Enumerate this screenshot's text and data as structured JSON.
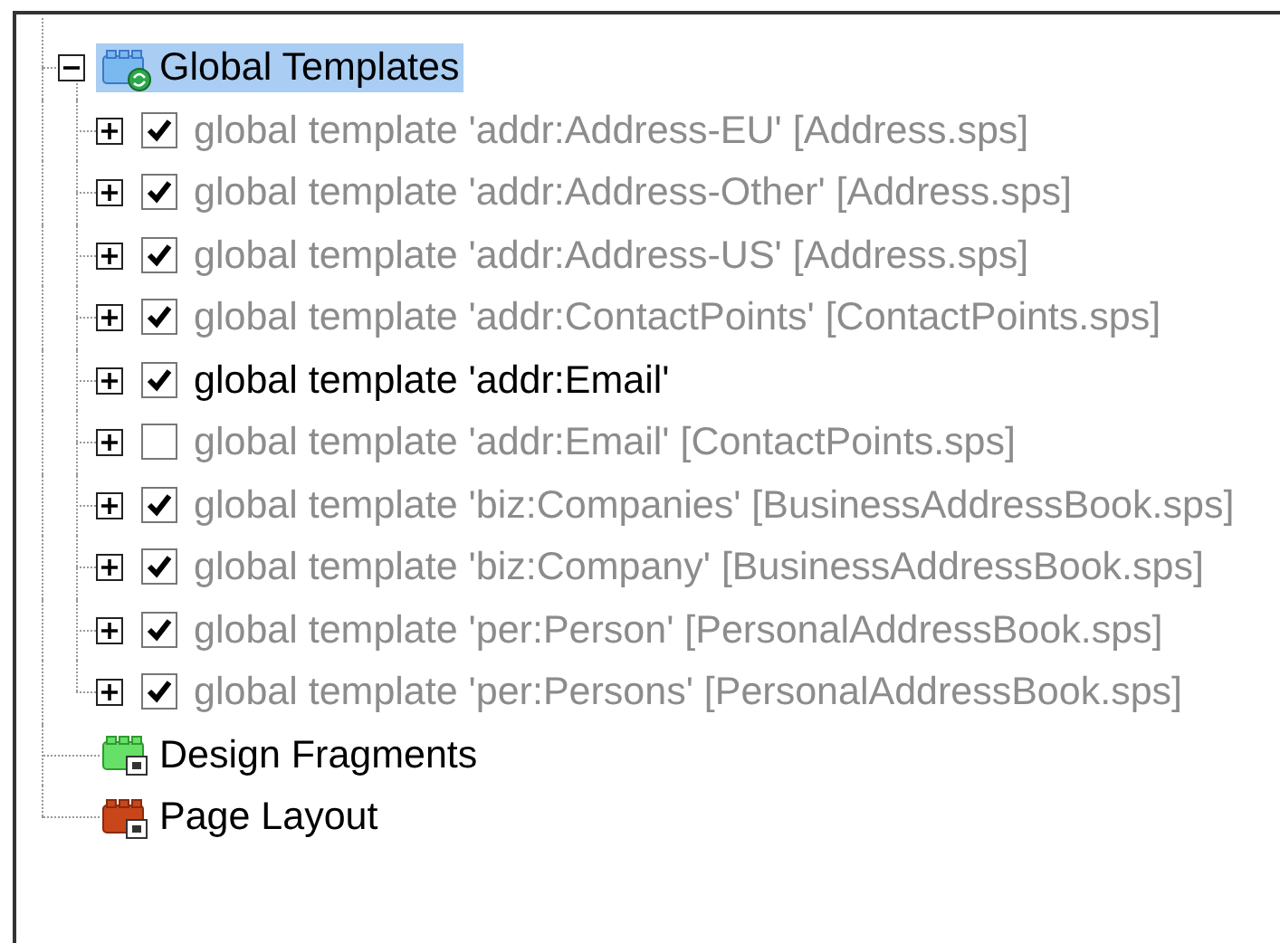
{
  "tree": [
    {
      "label": "Global Templates",
      "kind": "global",
      "expanded": true,
      "selected": true,
      "children": [
        {
          "label": "global template 'addr:Address-EU' [Address.sps]",
          "checked": true,
          "dimmed": true,
          "expanded": false
        },
        {
          "label": "global template 'addr:Address-Other' [Address.sps]",
          "checked": true,
          "dimmed": true,
          "expanded": false
        },
        {
          "label": "global template 'addr:Address-US' [Address.sps]",
          "checked": true,
          "dimmed": true,
          "expanded": false
        },
        {
          "label": "global template 'addr:ContactPoints' [ContactPoints.sps]",
          "checked": true,
          "dimmed": true,
          "expanded": false
        },
        {
          "label": "global template 'addr:Email'",
          "checked": true,
          "dimmed": false,
          "expanded": false
        },
        {
          "label": "global template 'addr:Email' [ContactPoints.sps]",
          "checked": false,
          "dimmed": true,
          "expanded": false
        },
        {
          "label": "global template 'biz:Companies' [BusinessAddressBook.sps]",
          "checked": true,
          "dimmed": true,
          "expanded": false
        },
        {
          "label": "global template 'biz:Company' [BusinessAddressBook.sps]",
          "checked": true,
          "dimmed": true,
          "expanded": false
        },
        {
          "label": "global template 'per:Person' [PersonalAddressBook.sps]",
          "checked": true,
          "dimmed": true,
          "expanded": false
        },
        {
          "label": "global template 'per:Persons' [PersonalAddressBook.sps]",
          "checked": true,
          "dimmed": true,
          "expanded": false
        }
      ]
    },
    {
      "label": "Design Fragments",
      "kind": "fragments",
      "selected": false
    },
    {
      "label": "Page Layout",
      "kind": "layout",
      "selected": false
    }
  ]
}
